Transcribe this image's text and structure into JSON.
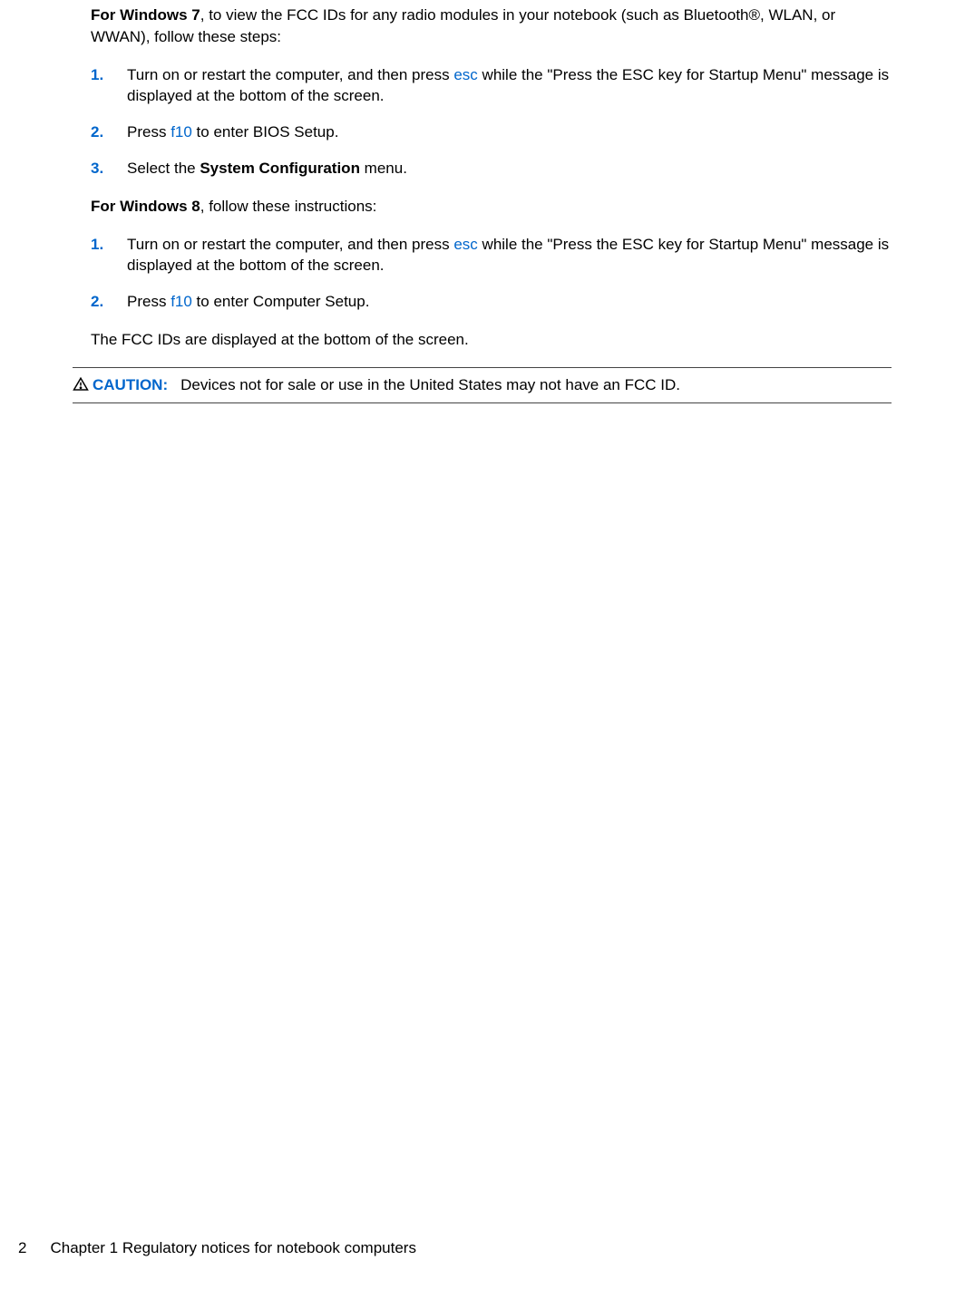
{
  "intro_win7": {
    "prefix_bold": "For Windows 7",
    "rest": ", to view the FCC IDs for any radio modules in your notebook (such as Bluetooth®, WLAN, or WWAN), follow these steps:"
  },
  "list_win7": [
    {
      "num": "1.",
      "before": "Turn on or restart the computer, and then press ",
      "key": "esc",
      "after": " while the \"Press the ESC key for Startup Menu\" message is displayed at the bottom of the screen."
    },
    {
      "num": "2.",
      "before": "Press ",
      "key": "f10",
      "after": " to enter BIOS Setup."
    },
    {
      "num": "3.",
      "before": "Select the ",
      "bold": "System Configuration",
      "after": " menu."
    }
  ],
  "intro_win8": {
    "prefix_bold": "For Windows 8",
    "rest": ", follow these instructions:"
  },
  "list_win8": [
    {
      "num": "1.",
      "before": "Turn on or restart the computer, and then press ",
      "key": "esc",
      "after": " while the \"Press the ESC key for Startup Menu\" message is displayed at the bottom of the screen."
    },
    {
      "num": "2.",
      "before": "Press ",
      "key": "f10",
      "after": " to enter Computer Setup."
    }
  ],
  "closing_para": "The FCC IDs are displayed at the bottom of the screen.",
  "caution": {
    "label": "CAUTION:",
    "text": "Devices not for sale or use in the United States may not have an FCC ID."
  },
  "footer": {
    "page_num": "2",
    "chapter": "Chapter 1   Regulatory notices for notebook computers"
  }
}
